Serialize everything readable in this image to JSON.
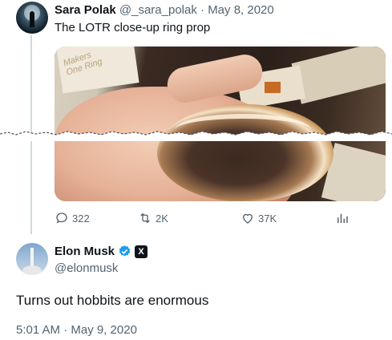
{
  "parent_tweet": {
    "author_name": "Sara Polak",
    "handle": "@_sara_polak",
    "separator": "·",
    "date": "May 8, 2020",
    "text": "The LOTR close-up ring prop",
    "media": {
      "box_text": "Makers\nOne Ring"
    },
    "actions": {
      "replies": "322",
      "retweets": "2K",
      "likes": "37K",
      "views_icon": "analytics-icon"
    }
  },
  "main_tweet": {
    "author_name": "Elon Musk",
    "handle": "@elonmusk",
    "verified_badge": "verified-check-icon",
    "affiliation_badge": "X",
    "text": "Turns out hobbits are enormous",
    "timestamp": "5:01 AM · May 9, 2020"
  },
  "colors": {
    "text_primary": "#0f1419",
    "text_secondary": "#536471",
    "verified_blue": "#1d9bf0",
    "divider": "#cfd9de"
  }
}
